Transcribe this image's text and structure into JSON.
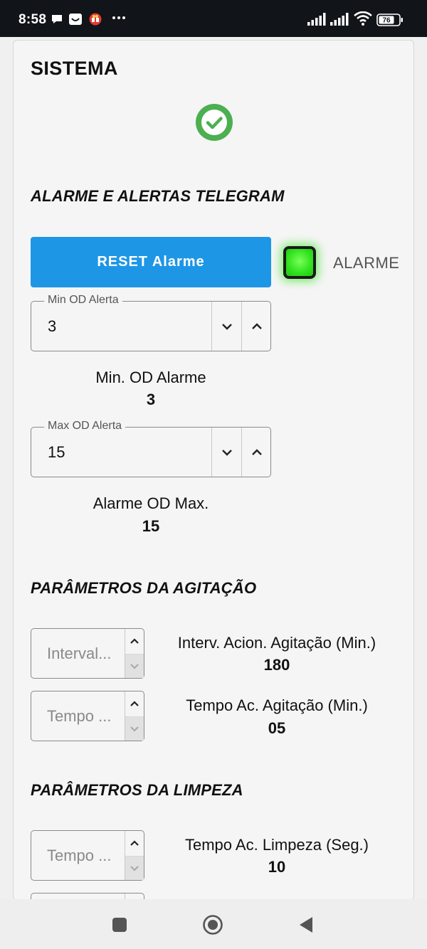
{
  "status_bar": {
    "time": "8:58",
    "icons_left": [
      "chat-bubble-icon",
      "inbox-icon",
      "gift-icon",
      "more-dots-icon"
    ],
    "icons_right": [
      "signal-icon",
      "signal-icon",
      "wifi-icon",
      "battery-icon"
    ],
    "battery_level": "76"
  },
  "page": {
    "title": "SISTEMA",
    "status_icon": "check-circle-icon",
    "status_color": "#4caf50"
  },
  "alarm_section": {
    "title": "ALARME E ALERTAS TELEGRAM",
    "reset_button": "RESET Alarme",
    "alarm_label": "ALARME",
    "alarm_led_color": "#2fe21d",
    "min_field": {
      "legend": "Min OD Alerta",
      "value": "3"
    },
    "min_alarm": {
      "label": "Min. OD Alarme",
      "value": "3"
    },
    "max_field": {
      "legend": "Max OD Alerta",
      "value": "15"
    },
    "max_alarm": {
      "label": "Alarme OD Max.",
      "value": "15"
    }
  },
  "agitation_section": {
    "title": "PARÂMETROS DA AGITAÇÃO",
    "interval": {
      "placeholder": "Interval...",
      "label": "Interv. Acion. Agitação (Min.)",
      "value": "180"
    },
    "time": {
      "placeholder": "Tempo ...",
      "label": "Tempo Ac. Agitação (Min.)",
      "value": "05"
    }
  },
  "cleaning_section": {
    "title": "PARÂMETROS DA LIMPEZA",
    "time": {
      "placeholder": "Tempo ...",
      "label": "Tempo Ac. Limpeza (Seg.)",
      "value": "10"
    }
  },
  "nav": {
    "buttons": [
      "recents-square-icon",
      "home-circle-icon",
      "back-triangle-icon"
    ]
  },
  "colors": {
    "accent": "#1e96e6",
    "status_bar": "#111418",
    "background": "#f5f5f5"
  }
}
